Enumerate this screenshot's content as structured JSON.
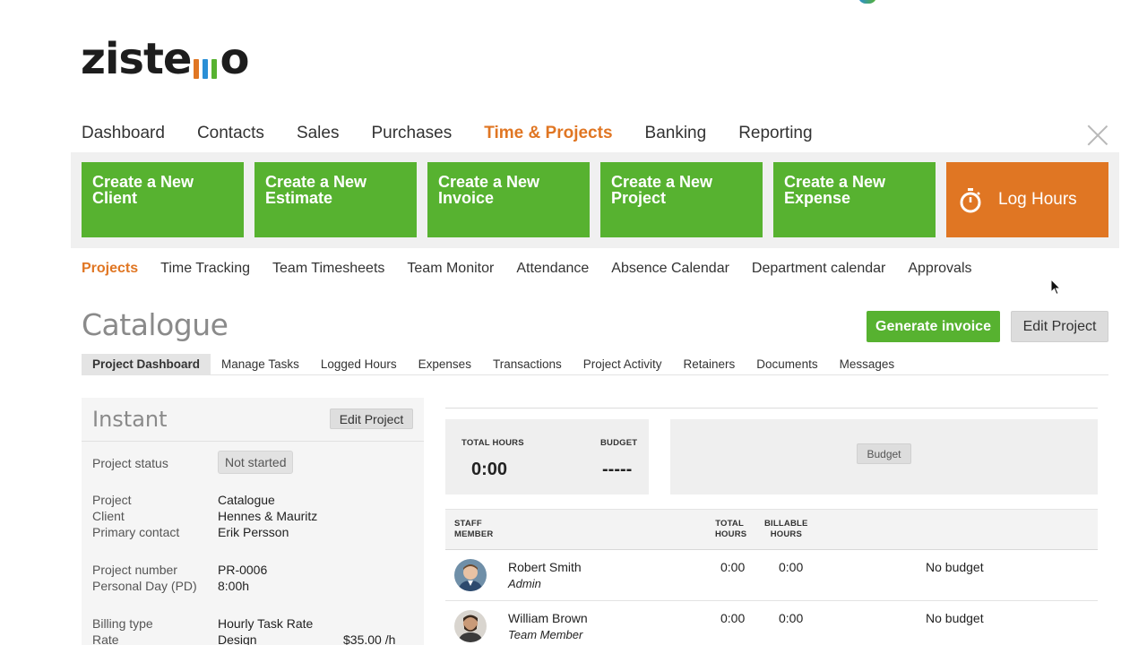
{
  "logo": {
    "part1": "zist",
    "part2": "e",
    "part3": "o"
  },
  "main_nav": [
    "Dashboard",
    "Contacts",
    "Sales",
    "Purchases",
    "Time & Projects",
    "Banking",
    "Reporting"
  ],
  "main_nav_active": "Time & Projects",
  "tiles": [
    {
      "line1": "Create a New",
      "line2": "Client"
    },
    {
      "line1": "Create a New",
      "line2": "Estimate"
    },
    {
      "line1": "Create a New",
      "line2": "Invoice"
    },
    {
      "line1": "Create a New",
      "line2": "Project"
    },
    {
      "line1": "Create a New",
      "line2": "Expense"
    }
  ],
  "log_hours": {
    "label": "Log Hours",
    "icon": "stopwatch-icon"
  },
  "sub_nav": [
    "Projects",
    "Time Tracking",
    "Team Timesheets",
    "Team Monitor",
    "Attendance",
    "Absence Calendar",
    "Department calendar",
    "Approvals"
  ],
  "sub_nav_active": "Projects",
  "page": {
    "title": "Catalogue",
    "generate_invoice": "Generate invoice",
    "edit_project": "Edit Project"
  },
  "tabs": [
    "Project Dashboard",
    "Manage Tasks",
    "Logged Hours",
    "Expenses",
    "Transactions",
    "Project Activity",
    "Retainers",
    "Documents",
    "Messages"
  ],
  "tabs_active": "Project Dashboard",
  "project_panel": {
    "title": "Instant",
    "edit_button": "Edit Project",
    "status_label": "Project status",
    "status_value": "Not started",
    "project_label": "Project",
    "project_value": "Catalogue",
    "client_label": "Client",
    "client_value": "Hennes & Mauritz",
    "contact_label": "Primary contact",
    "contact_value": "Erik Persson",
    "number_label": "Project number",
    "number_value": "PR-0006",
    "personal_day_label": "Personal Day (PD)",
    "personal_day_value": "8:00h",
    "billing_type_label": "Billing type",
    "billing_type_value": "Hourly Task Rate",
    "rate_label": "Rate",
    "rate_task": "Design",
    "rate_value": "$35.00 /h"
  },
  "stats": {
    "total_hours_label": "TOTAL HOURS",
    "total_hours_value": "0:00",
    "budget_label": "BUDGET",
    "budget_value": "-----",
    "budget_button": "Budget"
  },
  "staff_table": {
    "headers": {
      "staff_line1": "STAFF",
      "staff_line2": "MEMBER",
      "total_line1": "TOTAL",
      "total_line2": "HOURS",
      "billable_line1": "BILLABLE",
      "billable_line2": "HOURS"
    },
    "rows": [
      {
        "name": "Robert Smith",
        "role": "Admin",
        "total": "0:00",
        "billable": "0:00",
        "budget": "No budget"
      },
      {
        "name": "William Brown",
        "role": "Team Member",
        "total": "0:00",
        "billable": "0:00",
        "budget": "No budget"
      }
    ]
  },
  "colors": {
    "green": "#57b230",
    "orange": "#e07623",
    "blue": "#2a8fd6"
  }
}
